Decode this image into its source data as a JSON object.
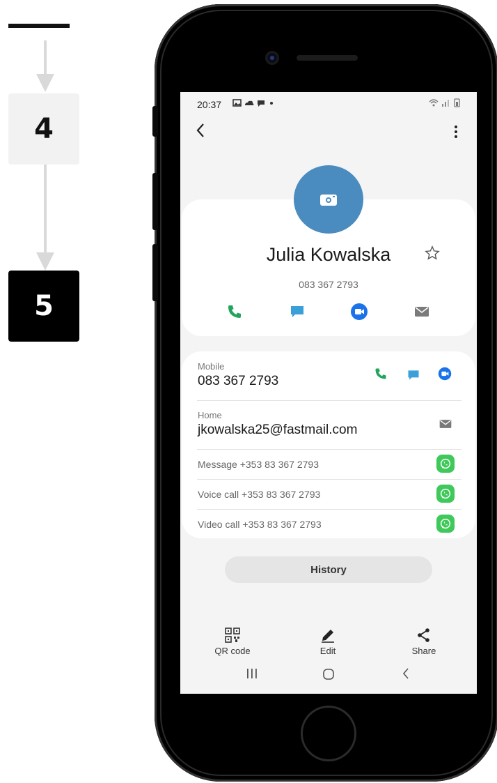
{
  "steps": {
    "step_4": "4",
    "step_5": "5"
  },
  "status_bar": {
    "time": "20:37"
  },
  "contact": {
    "name": "Julia Kowalska",
    "phone_summary": "083 367 2793"
  },
  "details": {
    "mobile_label": "Mobile",
    "mobile_value": "083 367 2793",
    "home_label": "Home",
    "home_value": "jkowalska25@fastmail.com",
    "whatsapp_message": "Message +353 83 367 2793",
    "whatsapp_voice": "Voice call +353 83 367 2793",
    "whatsapp_video": "Video call +353 83 367 2793"
  },
  "history_label": "History",
  "bottom_bar": {
    "qr_label": "QR code",
    "edit_label": "Edit",
    "share_label": "Share"
  },
  "colors": {
    "avatar": "#4a8cbf",
    "call_green": "#22a45d",
    "message_blue": "#3ba0d8",
    "video_blue": "#1a73e8",
    "whatsapp_green": "#3ec95a"
  }
}
